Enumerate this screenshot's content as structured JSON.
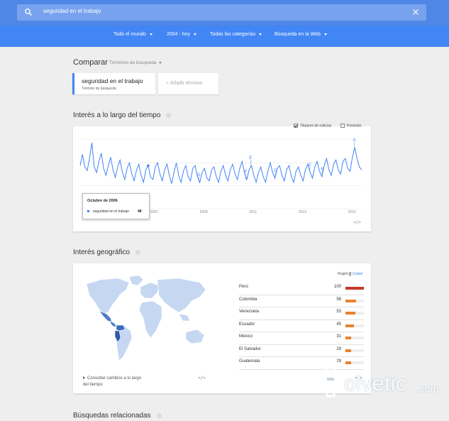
{
  "header": {
    "search_value": "seguridad en el trabajo",
    "search_icon": "search-icon",
    "clear_icon": "close-icon"
  },
  "filters": [
    {
      "label": "Todo el mundo"
    },
    {
      "label": "2004 - hoy"
    },
    {
      "label": "Todas las categorías"
    },
    {
      "label": "Búsqueda en la Web"
    }
  ],
  "compare": {
    "title": "Comparar",
    "subtitle": "Términos de búsqueda",
    "term": {
      "name": "seguridad en el trabajo",
      "type": "Término de búsqueda"
    },
    "add_term": "+ Añadir término"
  },
  "interest_time": {
    "title": "Interés a lo largo del tiempo",
    "option_news": "Titulares de noticias",
    "option_news_checked": true,
    "option_forecast": "Previsión",
    "option_forecast_checked": false,
    "tooltip": {
      "date": "Octubre de 2006",
      "series": "seguridad en el trabajo",
      "value": "48"
    },
    "embed": "</>"
  },
  "chart_data": {
    "type": "line",
    "series": [
      {
        "name": "seguridad en el trabajo",
        "color": "#4285f4"
      }
    ],
    "x_range": [
      2004,
      2015.4
    ],
    "ylim": [
      0,
      100
    ],
    "x_ticks": [
      "2007",
      "2009",
      "2011",
      "2013",
      "2015"
    ],
    "x_tick_values": [
      2007,
      2009,
      2011,
      2013,
      2015
    ],
    "values": [
      62,
      78,
      60,
      55,
      72,
      95,
      60,
      52,
      68,
      80,
      58,
      48,
      62,
      74,
      56,
      45,
      60,
      70,
      52,
      42,
      58,
      66,
      50,
      40,
      55,
      64,
      48,
      38,
      56,
      62,
      46,
      42,
      60,
      66,
      50,
      40,
      56,
      64,
      48,
      36,
      52,
      66,
      48,
      38,
      54,
      62,
      46,
      40,
      58,
      62,
      46,
      38,
      52,
      58,
      44,
      40,
      56,
      60,
      46,
      38,
      54,
      62,
      48,
      40,
      56,
      64,
      50,
      42,
      58,
      68,
      52,
      42,
      56,
      62,
      48,
      38,
      52,
      60,
      46,
      38,
      54,
      66,
      52,
      44,
      58,
      62,
      48,
      40,
      56,
      62,
      46,
      38,
      54,
      60,
      48,
      40,
      56,
      64,
      52,
      44,
      60,
      68,
      54,
      46,
      62,
      72,
      56,
      48,
      64,
      70,
      56,
      50,
      68,
      72,
      58,
      54,
      74,
      88,
      72,
      60,
      56
    ],
    "annotations": [
      {
        "label": "G",
        "x": 2008.8
      },
      {
        "label": "F",
        "x": 2010.7
      },
      {
        "label": "E",
        "x": 2010.9
      },
      {
        "label": "D",
        "x": 2011.9
      },
      {
        "label": "C",
        "x": 2013.3
      },
      {
        "label": "B",
        "x": 2013.8
      },
      {
        "label": "A",
        "x": 2015.1
      }
    ]
  },
  "geo": {
    "title": "Interés geográfico",
    "toggle_region": "Región",
    "toggle_city": "Ciudad",
    "rows": [
      {
        "name": "Perú",
        "value": "100"
      },
      {
        "name": "Colombia",
        "value": "58"
      },
      {
        "name": "Venezuela",
        "value": "53"
      },
      {
        "name": "Ecuador",
        "value": "45"
      },
      {
        "name": "México",
        "value": "31"
      },
      {
        "name": "El Salvador",
        "value": "29"
      },
      {
        "name": "Guatemala",
        "value": "29"
      }
    ],
    "values_numeric": [
      100,
      58,
      53,
      45,
      31,
      29,
      29
    ],
    "consult_link": "Consultar cambios a lo largo del tiempo",
    "embed": "</>"
  },
  "related": {
    "title": "Búsquedas relacionadas"
  },
  "watermark": {
    "text": "olvetic",
    "suffix": ".com"
  },
  "colors": {
    "header_dark": "#4f87e6",
    "header": "#4285f4",
    "map_highlight": "#4a7dc4",
    "bar_top": "#c0392b",
    "bar": "#e8822d"
  }
}
